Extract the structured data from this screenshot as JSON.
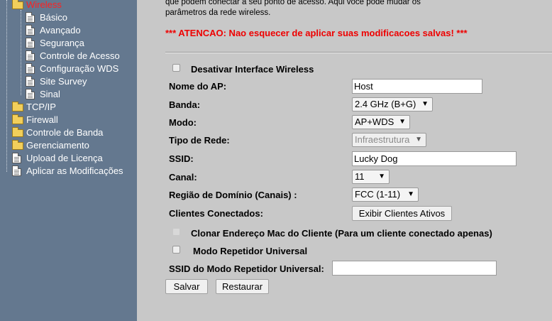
{
  "sidebar": {
    "items": [
      {
        "label": "Wireless",
        "icon": "folder-open-icon",
        "active": true
      },
      {
        "label": "Básico",
        "icon": "document-icon"
      },
      {
        "label": "Avançado",
        "icon": "document-icon"
      },
      {
        "label": "Segurança",
        "icon": "document-icon"
      },
      {
        "label": "Controle de Acesso",
        "icon": "document-icon"
      },
      {
        "label": "Configuração WDS",
        "icon": "document-icon"
      },
      {
        "label": "Site Survey",
        "icon": "document-icon"
      },
      {
        "label": "Sinal",
        "icon": "document-icon"
      },
      {
        "label": "TCP/IP",
        "icon": "folder-icon"
      },
      {
        "label": "Firewall",
        "icon": "folder-icon"
      },
      {
        "label": "Controle de Banda",
        "icon": "folder-icon"
      },
      {
        "label": "Gerenciamento",
        "icon": "folder-icon"
      },
      {
        "label": "Upload de Licença",
        "icon": "document-icon"
      },
      {
        "label": "Aplicar as Modificações",
        "icon": "document-icon"
      }
    ]
  },
  "main": {
    "intro_line1": "que podem conectar a seu ponto de acesso. Aqui você pode mudar os",
    "intro_line2": "parâmetros da rede wireless.",
    "warning": "*** ATENCAO: Nao esquecer de aplicar suas modificacoes salvas! ***",
    "disable_wireless_label": "Desativar Interface Wireless",
    "ap_name_label": "Nome do AP:",
    "ap_name_value": "Host",
    "band_label": "Banda:",
    "band_value": "2.4 GHz (B+G)",
    "mode_label": "Modo:",
    "mode_value": "AP+WDS",
    "network_type_label": "Tipo de Rede:",
    "network_type_value": "Infraestrutura",
    "ssid_label": "SSID:",
    "ssid_value": "Lucky Dog",
    "channel_label": "Canal:",
    "channel_value": "11",
    "domain_label": "Região de Domínio (Canais) :",
    "domain_value": "FCC (1-11)",
    "clients_label": "Clientes Conectados:",
    "clients_button": "Exibir Clientes Ativos",
    "clone_mac_label": "Clonar Endereço Mac do Cliente (Para um cliente conectado apenas)",
    "repeater_label": "Modo Repetidor Universal",
    "repeater_ssid_label": "SSID do Modo Repetidor Universal:",
    "repeater_ssid_value": "",
    "save_button": "Salvar",
    "reset_button": "Restaurar"
  },
  "colors": {
    "sidebar_bg": "#64788f",
    "page_bg": "#c8c8c8",
    "warning": "#ee0000",
    "active_menu": "#ff2020"
  }
}
